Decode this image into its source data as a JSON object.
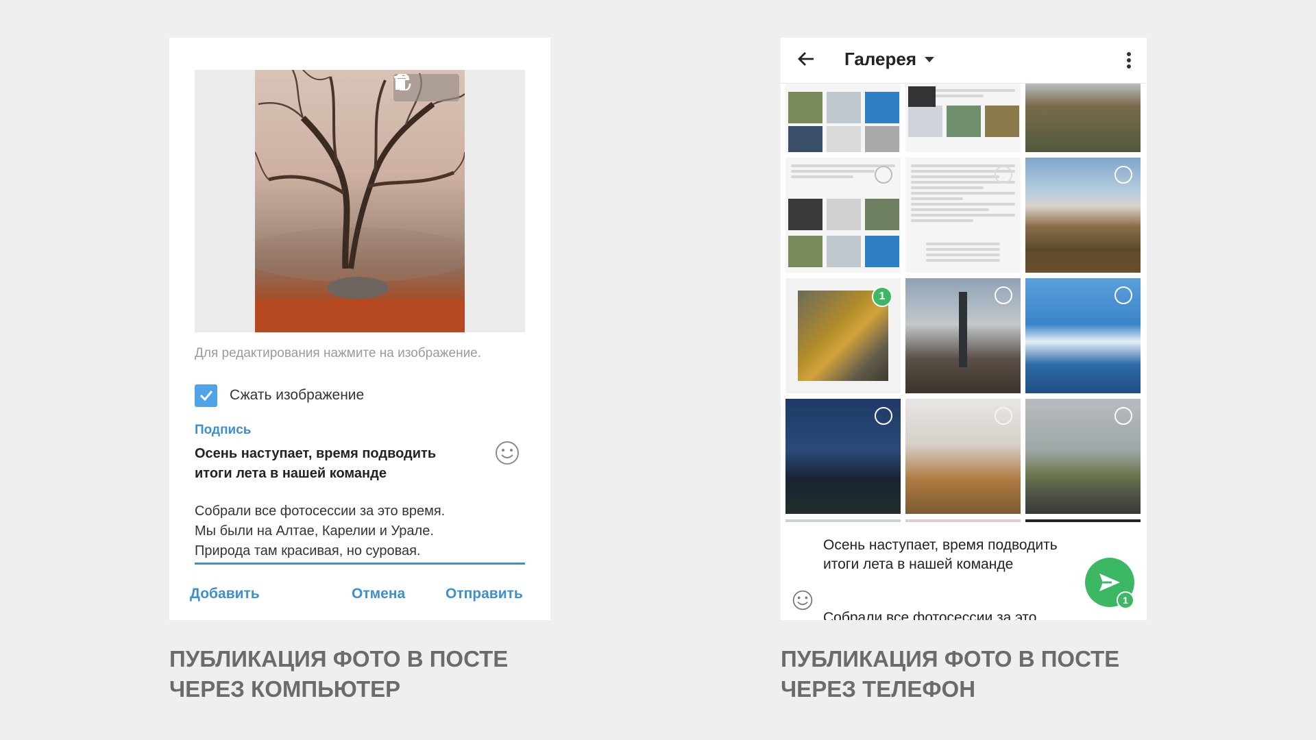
{
  "desktop": {
    "hint": "Для редактирования нажмите на изображение.",
    "compress_label": "Сжать изображение",
    "caption_label": "Подпись",
    "caption_title": "Осень наступает, время подводить итоги лета в нашей команде",
    "caption_body": "Собрали все фотосессии за это время.\nМы были на Алтае, Карелии и Урале.\nПрирода там красивая, но суровая.",
    "buttons": {
      "add": "Добавить",
      "cancel": "Отмена",
      "send": "Отправить"
    },
    "tools": [
      "replace-icon",
      "trash-icon"
    ]
  },
  "phone": {
    "title": "Галерея",
    "selected_badge": "1",
    "compose_text": "Осень наступает, время подводить итоги лета в нашей команде",
    "compose_more": "Собрали все фотосессии за это",
    "send_count": "1"
  },
  "captions": {
    "left": "ПУБЛИКАЦИЯ ФОТО В ПОСТЕ ЧЕРЕЗ КОМПЬЮТЕР",
    "right": "ПУБЛИКАЦИЯ ФОТО В ПОСТЕ ЧЕРЕЗ ТЕЛЕФОН"
  },
  "colors": {
    "accent_blue": "#3d8fcf",
    "checkbox_blue": "#4fa3e6",
    "send_green": "#3cb764",
    "caption_gray": "#6b6b6b"
  }
}
